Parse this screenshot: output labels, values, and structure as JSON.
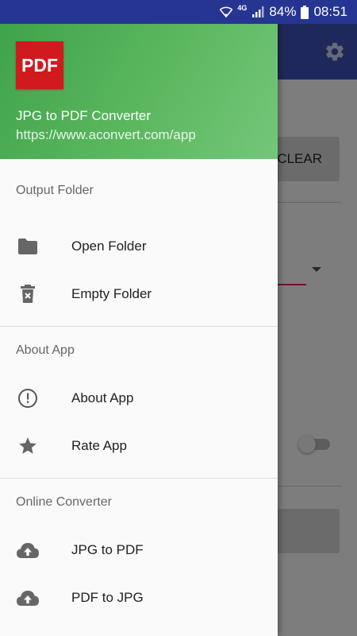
{
  "status_bar": {
    "network": "4G",
    "battery": "84%",
    "time": "08:51"
  },
  "background_app": {
    "clear_label": "CLEAR",
    "settings_icon": "gear-icon"
  },
  "drawer": {
    "logo_text": "PDF",
    "app_name": "JPG to PDF Converter",
    "app_url": "https://www.aconvert.com/app",
    "sections": [
      {
        "title": "Output Folder",
        "items": [
          {
            "label": "Open Folder",
            "icon": "folder-icon"
          },
          {
            "label": "Empty Folder",
            "icon": "trash-icon"
          }
        ]
      },
      {
        "title": "About App",
        "items": [
          {
            "label": "About App",
            "icon": "info-icon"
          },
          {
            "label": "Rate App",
            "icon": "star-icon"
          }
        ]
      },
      {
        "title": "Online Converter",
        "items": [
          {
            "label": "JPG to PDF",
            "icon": "cloud-upload-icon"
          },
          {
            "label": "PDF to JPG",
            "icon": "cloud-upload-icon"
          }
        ]
      }
    ]
  },
  "colors": {
    "status_bar": "#263591",
    "header_green": "#4caf50",
    "logo_red": "#d11a1e",
    "icon_gray": "#666666"
  }
}
